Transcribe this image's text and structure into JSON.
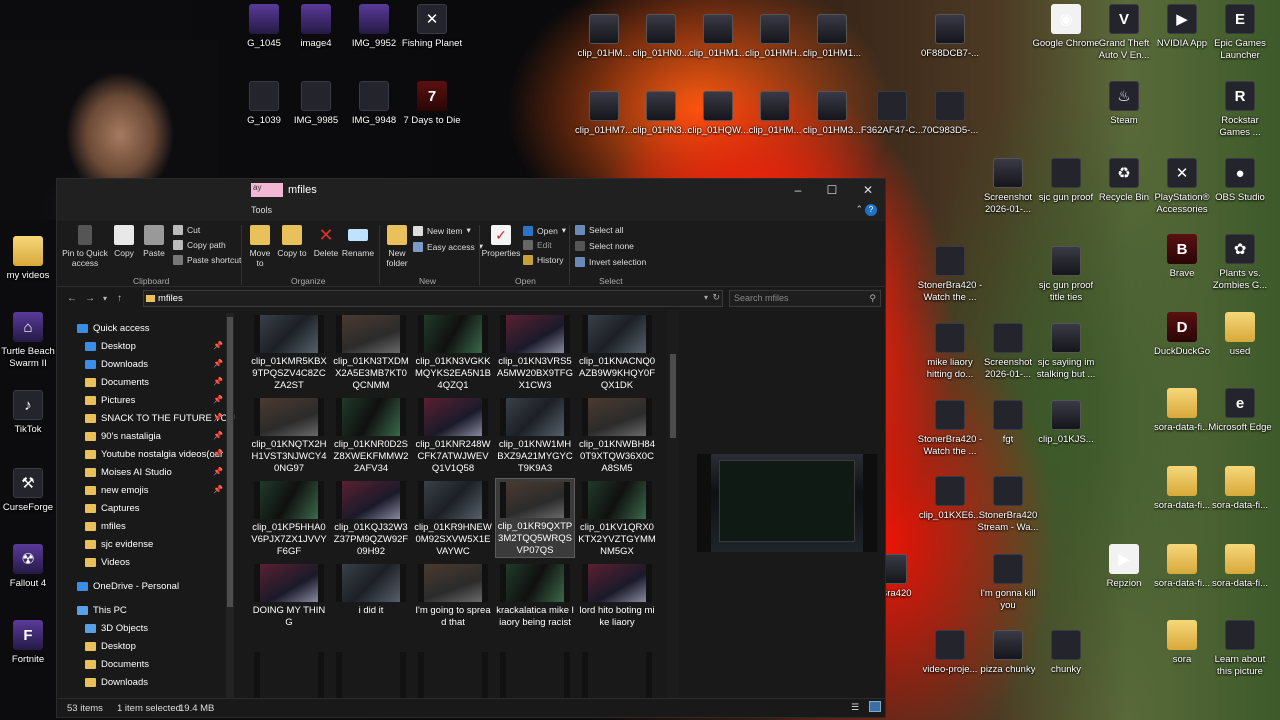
{
  "desktop": {
    "top_icons": [
      {
        "label": "G_1045"
      },
      {
        "label": "image4"
      },
      {
        "label": "IMG_9952"
      },
      {
        "label": "Fishing Planet"
      },
      {
        "label": "G_1039"
      },
      {
        "label": "IMG_9985"
      },
      {
        "label": "IMG_9948"
      },
      {
        "label": "7 Days to Die"
      }
    ],
    "clip_row1": [
      "clip_01HM...",
      "clip_01HN0...",
      "clip_01HM1...",
      "clip_01HMH...",
      "clip_01HM1..."
    ],
    "clip_row2": [
      "clip_01HM7...",
      "clip_01HN3...",
      "clip_01HQW...",
      "clip_01HM...",
      "clip_01HM3..."
    ],
    "left_icons": [
      {
        "label": "my videos"
      },
      {
        "label": "Turtle Beach Swarm II"
      },
      {
        "label": "TikTok"
      },
      {
        "label": "CurseForge"
      },
      {
        "label": "Fallout 4"
      },
      {
        "label": "Fortnite"
      }
    ],
    "mid_icons": [
      {
        "label": "0F88DCB7-..."
      },
      {
        "label": "F362AF47-C..."
      },
      {
        "label": "70C983D5-..."
      },
      {
        "label": "Screenshot 2026-01-..."
      },
      {
        "label": "sjc gun proof"
      },
      {
        "label": "StonerBra420 - Watch the ..."
      },
      {
        "label": "sjc gun proof title ties"
      },
      {
        "label": "mike liaory hitting do..."
      },
      {
        "label": "Screenshot 2026-01-..."
      },
      {
        "label": "sjc sayiing im stalking but ..."
      },
      {
        "label": "StonerBra420 - Watch the ..."
      },
      {
        "label": "fgt"
      },
      {
        "label": "clip_01KJS..."
      },
      {
        "label": "clip_01KXE6..."
      },
      {
        "label": "StonerBra420 Stream - Wa..."
      },
      {
        "label": "erBra420"
      },
      {
        "label": "I'm gonna kill you"
      },
      {
        "label": "video-proje..."
      },
      {
        "label": "pizza chunky"
      },
      {
        "label": "chunky"
      }
    ],
    "right_icons": [
      {
        "label": "Google Chrome"
      },
      {
        "label": "Grand Theft Auto V En..."
      },
      {
        "label": "NVIDIA App"
      },
      {
        "label": "Epic Games Launcher"
      },
      {
        "label": "Steam"
      },
      {
        "label": "Rockstar Games ..."
      },
      {
        "label": "Recycle Bin"
      },
      {
        "label": "PlayStation® Accessories"
      },
      {
        "label": "OBS Studio"
      },
      {
        "label": "Brave"
      },
      {
        "label": "Plants vs. Zombies G..."
      },
      {
        "label": "DuckDuckGo"
      },
      {
        "label": "used"
      },
      {
        "label": "sora-data-fi..."
      },
      {
        "label": "Microsoft Edge"
      },
      {
        "label": "sora-data-fi..."
      },
      {
        "label": "sora-data-fi..."
      },
      {
        "label": "Repzion"
      },
      {
        "label": "sora-data-fi..."
      },
      {
        "label": "sora-data-fi..."
      },
      {
        "label": "sora"
      },
      {
        "label": "Learn about this picture"
      }
    ]
  },
  "explorer": {
    "title": "mfiles",
    "title_tag": "ay",
    "tools_tab": "Tools",
    "ribbon": {
      "pin": "Pin to Quick access",
      "copy": "Copy",
      "paste": "Paste",
      "cut": "Cut",
      "copy_path": "Copy path",
      "paste_shortcut": "Paste shortcut",
      "clipboard_group": "Clipboard",
      "move_to": "Move to",
      "copy_to": "Copy to",
      "delete": "Delete",
      "rename": "Rename",
      "organize_group": "Organize",
      "new_folder": "New folder",
      "new_item": "New item",
      "easy_access": "Easy access",
      "new_group": "New",
      "properties": "Properties",
      "open": "Open",
      "edit": "Edit",
      "history": "History",
      "open_group": "Open",
      "select_all": "Select all",
      "select_none": "Select none",
      "invert_selection": "Invert selection",
      "select_group": "Select"
    },
    "address": {
      "path": "mfiles",
      "search_placeholder": "Search mfiles"
    },
    "nav": {
      "quick_access": "Quick access",
      "items": [
        {
          "label": "Desktop",
          "pinned": true
        },
        {
          "label": "Downloads",
          "pinned": true
        },
        {
          "label": "Documents",
          "pinned": true
        },
        {
          "label": "Pictures",
          "pinned": true
        },
        {
          "label": "SNACK TO THE FUTURE YOU1",
          "pinned": true
        },
        {
          "label": "90's nastaligia",
          "pinned": true
        },
        {
          "label": "Youtube nostalgia videos(our",
          "pinned": true
        },
        {
          "label": "Moises AI Studio",
          "pinned": true
        },
        {
          "label": "new emojis",
          "pinned": true
        },
        {
          "label": "Captures",
          "pinned": false
        },
        {
          "label": "mfiles",
          "pinned": false
        },
        {
          "label": "sjc evidense",
          "pinned": false
        },
        {
          "label": "Videos",
          "pinned": false
        }
      ],
      "onedrive": "OneDrive - Personal",
      "this_pc": "This PC",
      "pc_items": [
        "3D Objects",
        "Desktop",
        "Documents",
        "Downloads"
      ]
    },
    "files": [
      "clip_01KMR5KBX9TPQSZV4C8ZCZA2ST",
      "clip_01KN3TXDMX2A5E3MB7KT0QCNMM",
      "clip_01KN3VGKKMQYKS2EA5N1B4QZQ1",
      "clip_01KN3VRS5A5MW20BX9TFGX1CW3",
      "clip_01KNACNQ0AZB9W9KHQY0FQX1DK",
      "clip_01KNQTX2HH1VST3NJWCY40NG97",
      "clip_01KNR0D2SZ8XWEKFMMW22AFV34",
      "clip_01KNR248WCFK7ATWJWEVQ1V1Q58",
      "clip_01KNW1MHBXZ9A21MYGYCT9K9A3",
      "clip_01KNWBH840T9XTQW36X0CA8SM5",
      "clip_01KP5HHA0V6PJX7ZX1JVVYF6GF",
      "clip_01KQJ32W3Z37PM9QZW92F09H92",
      "clip_01KR9HNEW0M92SXVW5X1EVAYWC",
      "clip_01KR9QXTP3M2TQQ5WRQSVP07QS",
      "clip_01KV1QRX0KTX2YVZTGYMMNM5GX",
      "DOING MY THING",
      "i did it",
      "I'm going to spread that",
      "krackalatica mike liaory being racist",
      "lord hito boting mike liaory"
    ],
    "selected_index": 13,
    "status": {
      "count": "53 items",
      "selected": "1 item selected",
      "size": "19.4 MB"
    }
  }
}
